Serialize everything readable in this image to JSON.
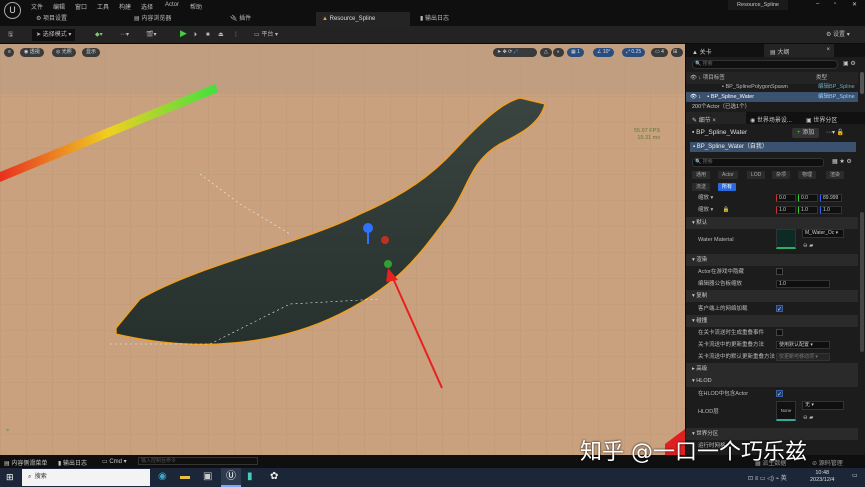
{
  "menu": [
    "文件",
    "编辑",
    "窗口",
    "工具",
    "构建",
    "选择",
    "Actor",
    "帮助"
  ],
  "window_title": "Resource_Spline",
  "tabs": [
    {
      "label": "项目设置"
    },
    {
      "label": "内容浏览器"
    },
    {
      "label": "插件"
    },
    {
      "label": "Resource_Spline"
    },
    {
      "label": "输出日志"
    }
  ],
  "toolbar": {
    "mode": "选择模式",
    "platform": "平台",
    "settings": "设置"
  },
  "viewport": {
    "perspective": "透视",
    "lit": "光照",
    "show": "显示",
    "fps": "55.97 FPS",
    "ms": "19.31 ms",
    "grid_snap": "1",
    "rot_snap": "10°",
    "scale_snap": "0.25",
    "cam_speed": "4"
  },
  "outliner": {
    "tab_level": "关卡",
    "tab_outliner": "大纲",
    "search_placeholder": "搜索",
    "col_label": "项目标签",
    "col_type": "类型",
    "items": [
      {
        "name": "BP_SplinePolygonSpawn",
        "type": "编辑BP_Spline"
      },
      {
        "name": "BP_Spline_Water",
        "type": "编辑BP_Spline"
      }
    ],
    "count": "200个Actor（已选1个）"
  },
  "details": {
    "tab_details": "细节",
    "tab_world": "世界场景设...",
    "tab_partition": "世界分区",
    "actor_name": "BP_Spline_Water",
    "add": "添加",
    "component": "BP_Spline_Water（自我）",
    "search_placeholder": "搜索",
    "cats": [
      "通用",
      "Actor",
      "LOD",
      "杂项",
      "物理",
      "渲染",
      "流送",
      "所有"
    ],
    "transform": {
      "loc_label": "缩放",
      "scale_label": "缩放",
      "loc": [
        "0.0",
        "0.0",
        "89.999"
      ],
      "scale": [
        "1.0",
        "1.0",
        "1.0"
      ]
    },
    "sections": {
      "default": "默认",
      "render": "渲染",
      "replication": "复制",
      "collision": "碰撞",
      "advanced": "高级",
      "hlod": "HLOD",
      "world_partition": "世界分区"
    },
    "water_material_label": "Water Material",
    "water_material_value": "M_Water_Oc",
    "hidden_label": "Actor在游戏中隐藏",
    "billboard_label": "编辑器公告板缩放",
    "billboard_value": "1.0",
    "net_load_label": "客户端上的网络加载",
    "overlap_label": "在关卡流送时生成重叠事件",
    "update_method_label": "关卡流送中的更新重叠方法",
    "update_method_value": "使用默认配置",
    "default_update_label": "关卡流送中的默认更新重叠方法",
    "default_update_value": "仅更新可移动项",
    "include_hlod_label": "在HLOD中包含Actor",
    "hlod_layer_label": "HLOD层",
    "hlod_layer_value": "无",
    "hlod_thumb": "None",
    "wp_row": "运行时网格"
  },
  "status": {
    "drawer": "内容侧滑菜单",
    "output": "输出日志",
    "cmd": "Cmd",
    "cmd_placeholder": "输入控制台命令",
    "derived": "派生数据",
    "source": "源码管理"
  },
  "taskbar": {
    "search": "搜索",
    "time": "10:48",
    "date": "2023/12/4"
  },
  "watermark": "知乎 @一口一个巧乐兹"
}
